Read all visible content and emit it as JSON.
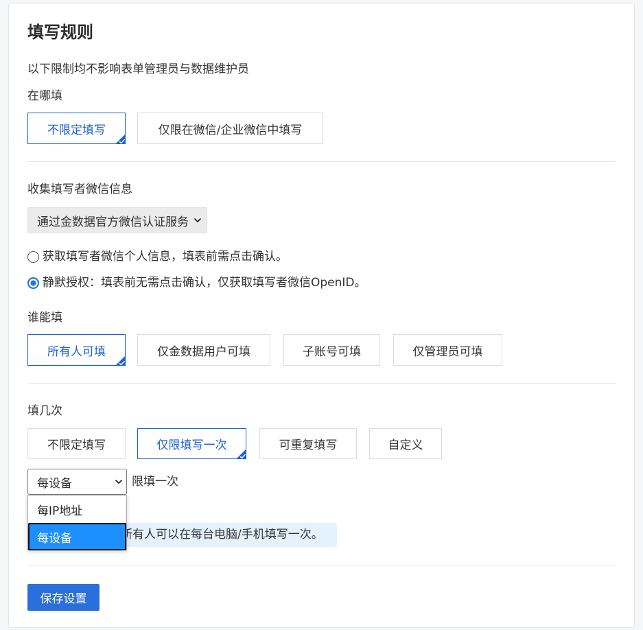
{
  "title": "填写规则",
  "note": "以下限制均不影响表单管理员与数据维护员",
  "where": {
    "label": "在哪填",
    "options": [
      {
        "label": "不限定填写",
        "selected": true
      },
      {
        "label": "仅限在微信/企业微信中填写",
        "selected": false
      }
    ]
  },
  "wechat": {
    "label": "收集填写者微信信息",
    "select_value": "通过金数据官方微信认证服务",
    "radios": [
      {
        "label": "获取填写者微信个人信息，填表前需点击确认。",
        "checked": false
      },
      {
        "label": "静默授权：填表前无需点击确认，仅获取填写者微信OpenID。",
        "checked": true
      }
    ]
  },
  "who": {
    "label": "谁能填",
    "options": [
      {
        "label": "所有人可填",
        "selected": true
      },
      {
        "label": "仅金数据用户可填",
        "selected": false
      },
      {
        "label": "子账号可填",
        "selected": false
      },
      {
        "label": "仅管理员可填",
        "selected": false
      }
    ]
  },
  "times": {
    "label": "填几次",
    "options": [
      {
        "label": "不限定填写",
        "selected": false
      },
      {
        "label": "仅限填写一次",
        "selected": true
      },
      {
        "label": "可重复填写",
        "selected": false
      },
      {
        "label": "自定义",
        "selected": false
      }
    ],
    "limit_select": {
      "value": "每设备",
      "options": [
        {
          "label": "每IP地址",
          "highlighted": false
        },
        {
          "label": "每设备",
          "highlighted": true
        }
      ]
    },
    "limit_suffix": "限填一次",
    "info": "所有人可以在每台电脑/手机填写一次。"
  },
  "save_label": "保存设置",
  "colors": {
    "accent": "#1c5fd1",
    "save_bg": "#2b6fdc",
    "highlight": "#1e8fff",
    "info_bg": "#e4f2fd"
  },
  "icons": {
    "check_corner": "check-corner-icon",
    "select_arrow": "chevron-down-icon"
  }
}
